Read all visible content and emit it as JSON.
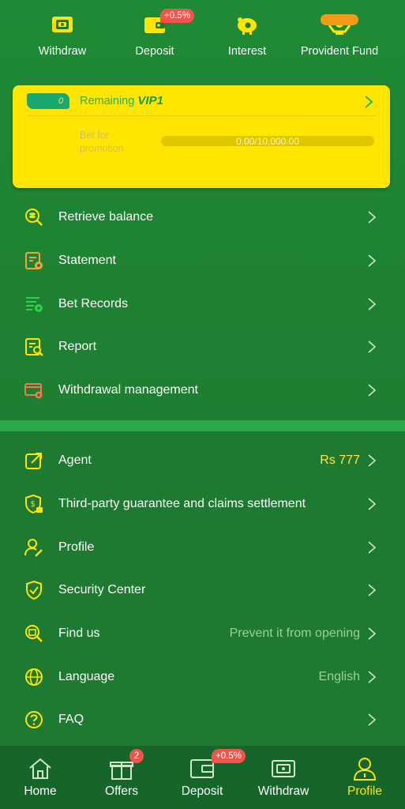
{
  "quick_actions": [
    {
      "label": "Withdraw",
      "icon": "withdraw-icon"
    },
    {
      "label": "Deposit",
      "icon": "deposit-wallet-icon",
      "badge": "+0.5%"
    },
    {
      "label": "Interest",
      "icon": "piggy-bank-icon"
    },
    {
      "label": "Provident Fund",
      "icon": "provident-fund-icon"
    }
  ],
  "vip": {
    "tag": "0",
    "remaining_label": "Remaining",
    "level": "VIP1",
    "bet_label": "Bet for promotion",
    "progress_text": "0.00/10,000.00",
    "progress_fraction": 0
  },
  "menu_group1": [
    {
      "label": "Retrieve balance",
      "icon": "coins-search-icon"
    },
    {
      "label": "Statement",
      "icon": "statement-icon"
    },
    {
      "label": "Bet Records",
      "icon": "bet-records-icon"
    },
    {
      "label": "Report",
      "icon": "report-icon"
    },
    {
      "label": "Withdrawal management",
      "icon": "withdrawal-management-icon"
    }
  ],
  "menu_group2": [
    {
      "label": "Agent",
      "value": "Rs 777",
      "icon": "agent-share-icon"
    },
    {
      "label": "Third-party guarantee and claims settlement",
      "value": "",
      "icon": "guarantee-shield-icon"
    },
    {
      "label": "Profile",
      "value": "",
      "icon": "profile-edit-icon"
    },
    {
      "label": "Security Center",
      "value": "",
      "icon": "security-shield-icon"
    },
    {
      "label": "Find us",
      "value": "Prevent it from opening",
      "icon": "find-us-icon"
    },
    {
      "label": "Language",
      "value": "English",
      "icon": "globe-icon"
    },
    {
      "label": "FAQ",
      "value": "",
      "icon": "faq-icon"
    }
  ],
  "bottom_nav": [
    {
      "label": "Home",
      "icon": "home-icon"
    },
    {
      "label": "Offers",
      "icon": "gift-icon",
      "badge": "2"
    },
    {
      "label": "Deposit",
      "icon": "wallet-icon",
      "badge": "+0.5%"
    },
    {
      "label": "Withdraw",
      "icon": "withdraw-ticket-icon"
    },
    {
      "label": "Profile",
      "icon": "user-icon",
      "active": true
    }
  ],
  "colors": {
    "background": "#1e7a32",
    "accent_yellow": "#ffe500",
    "badge_red": "#f3534b",
    "nav_bg": "#16652a"
  }
}
